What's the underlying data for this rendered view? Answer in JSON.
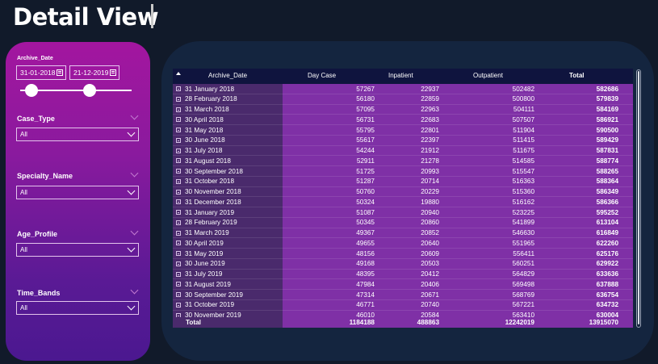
{
  "page": {
    "title": "Detail View"
  },
  "filters": {
    "archive_label": "Archive_Date",
    "date_from": "31-01-2018",
    "date_to": "21-12-2019",
    "range_start_fraction": 0.1,
    "range_end_fraction": 0.62,
    "slicers": [
      {
        "label": "Case_Type",
        "value": "All"
      },
      {
        "label": "Specialty_Name",
        "value": "All"
      },
      {
        "label": "Age_Profile",
        "value": "All"
      },
      {
        "label": "Time_Bands",
        "value": "All"
      }
    ]
  },
  "table": {
    "headers": [
      "Archive_Date",
      "Day Case",
      "Inpatient",
      "Outpatient",
      "Total"
    ],
    "rows": [
      [
        "31 January 2018",
        "57267",
        "22937",
        "502482",
        "582686"
      ],
      [
        "28 February 2018",
        "56180",
        "22859",
        "500800",
        "579839"
      ],
      [
        "31 March 2018",
        "57095",
        "22963",
        "504111",
        "584169"
      ],
      [
        "30 April 2018",
        "56731",
        "22683",
        "507507",
        "586921"
      ],
      [
        "31 May 2018",
        "55795",
        "22801",
        "511904",
        "590500"
      ],
      [
        "30 June 2018",
        "55617",
        "22397",
        "511415",
        "589429"
      ],
      [
        "31 July 2018",
        "54244",
        "21912",
        "511675",
        "587831"
      ],
      [
        "31 August 2018",
        "52911",
        "21278",
        "514585",
        "588774"
      ],
      [
        "30 September 2018",
        "51725",
        "20993",
        "515547",
        "588265"
      ],
      [
        "31 October 2018",
        "51287",
        "20714",
        "516363",
        "588364"
      ],
      [
        "30 November 2018",
        "50760",
        "20229",
        "515360",
        "586349"
      ],
      [
        "31 December 2018",
        "50324",
        "19880",
        "516162",
        "586366"
      ],
      [
        "31 January 2019",
        "51087",
        "20940",
        "523225",
        "595252"
      ],
      [
        "28 February 2019",
        "50345",
        "20860",
        "541899",
        "613104"
      ],
      [
        "31 March 2019",
        "49367",
        "20852",
        "546630",
        "616849"
      ],
      [
        "30 April 2019",
        "49655",
        "20640",
        "551965",
        "622260"
      ],
      [
        "31 May 2019",
        "48156",
        "20609",
        "556411",
        "625176"
      ],
      [
        "30 June 2019",
        "49168",
        "20503",
        "560251",
        "629922"
      ],
      [
        "31 July 2019",
        "48395",
        "20412",
        "564829",
        "633636"
      ],
      [
        "31 August 2019",
        "47984",
        "20406",
        "569498",
        "637888"
      ],
      [
        "30 September 2019",
        "47314",
        "20671",
        "568769",
        "636754"
      ],
      [
        "31 October 2019",
        "46771",
        "20740",
        "567221",
        "634732"
      ],
      [
        "30 November 2019",
        "46010",
        "20584",
        "563410",
        "630004"
      ]
    ],
    "total": [
      "Total",
      "1184188",
      "488863",
      "12242019",
      "13915070"
    ]
  }
}
